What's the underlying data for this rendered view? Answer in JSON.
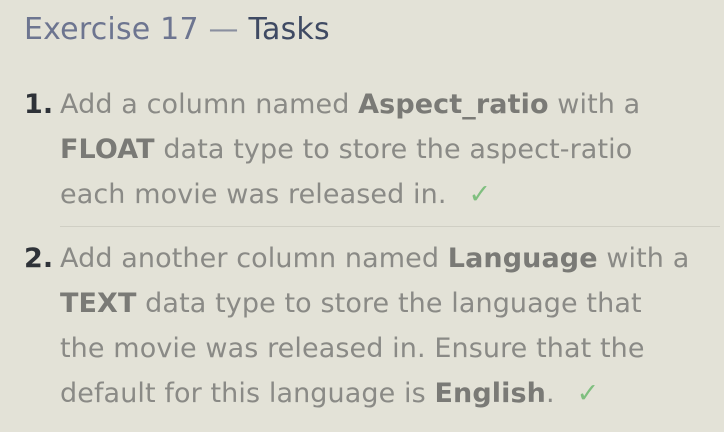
{
  "header": {
    "exercise": "Exercise 17",
    "separator": "—",
    "title": "Tasks"
  },
  "tasks": [
    {
      "number": "1.",
      "lines": [
        [
          "Add a column named ",
          "Aspect_ratio",
          " with a"
        ],
        [
          "FLOAT",
          " data type to store the aspect-ratio"
        ],
        [
          "each movie was released in."
        ]
      ],
      "check": "✓"
    },
    {
      "number": "2.",
      "lines": [
        [
          "Add another column named ",
          "Language",
          " with a"
        ],
        [
          "TEXT",
          " data type to store the language that"
        ],
        [
          "the movie was released in. Ensure that the"
        ],
        [
          "default for this language is ",
          "English",
          "."
        ]
      ],
      "check": "✓"
    }
  ]
}
